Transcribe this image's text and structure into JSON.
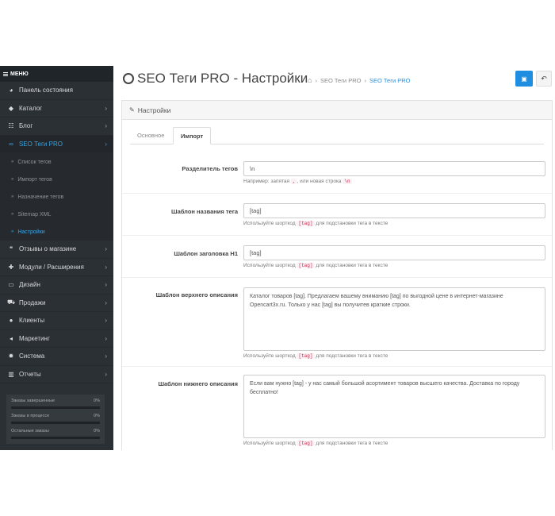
{
  "menu": {
    "title": "МЕНЮ"
  },
  "nav": [
    {
      "label": "Панель состояния",
      "icon": "dashboard-icon",
      "glyph": "◕",
      "chevron": false,
      "active": false
    },
    {
      "label": "Каталог",
      "icon": "tag-icon",
      "glyph": "◆",
      "chevron": true,
      "active": false
    },
    {
      "label": "Блог",
      "icon": "list-icon",
      "glyph": "☷",
      "chevron": true,
      "active": false
    },
    {
      "label": "SEO Теги PRO",
      "icon": "link-icon",
      "glyph": "∞",
      "chevron": true,
      "active": true
    }
  ],
  "subnav": [
    {
      "label": "Список тегов",
      "active": false
    },
    {
      "label": "Импорт тегов",
      "active": false
    },
    {
      "label": "Назначение тегов",
      "active": false
    },
    {
      "label": "Sitemap XML",
      "active": false
    },
    {
      "label": "Настройки",
      "active": true
    }
  ],
  "nav2": [
    {
      "label": "Отзывы о магазине",
      "icon": "comments-icon",
      "glyph": "❝",
      "chevron": true
    },
    {
      "label": "Модули / Расширения",
      "icon": "puzzle-icon",
      "glyph": "✚",
      "chevron": true
    },
    {
      "label": "Дизайн",
      "icon": "monitor-icon",
      "glyph": "▭",
      "chevron": true
    },
    {
      "label": "Продажи",
      "icon": "cart-icon",
      "glyph": "⛟",
      "chevron": true
    },
    {
      "label": "Клиенты",
      "icon": "user-icon",
      "glyph": "●",
      "chevron": true
    },
    {
      "label": "Маркетинг",
      "icon": "share-icon",
      "glyph": "◂",
      "chevron": true
    },
    {
      "label": "Система",
      "icon": "gear-icon",
      "glyph": "✹",
      "chevron": true
    },
    {
      "label": "Отчеты",
      "icon": "bar-chart-icon",
      "glyph": "▥",
      "chevron": true
    }
  ],
  "stats": [
    {
      "label": "Заказы завершенные",
      "value": "0%"
    },
    {
      "label": "Заказы в процессе",
      "value": "0%"
    },
    {
      "label": "Остальные заказы",
      "value": "0%"
    }
  ],
  "header": {
    "title": "SEO Теги PRO - Настройки",
    "breadcrumb": [
      "SEO Теги PRO",
      "SEO Теги PRO"
    ]
  },
  "panel": {
    "title": "Настройки",
    "tabs": [
      "Основное",
      "Импорт"
    ]
  },
  "form": {
    "separator": {
      "label": "Разделитель тегов",
      "value": "\\n",
      "help_prefix": "Например: запятая",
      "help_code1": ",",
      "help_mid": ", или новая строка",
      "help_code2": "\\n"
    },
    "name_tpl": {
      "label": "Шаблон названия тега",
      "value": "[tag]",
      "help_prefix": "Используйте шорткод",
      "help_code": "[tag]",
      "help_suffix": "для подстановки тега в тексте"
    },
    "h1_tpl": {
      "label": "Шаблон заголовка H1",
      "value": "[tag]",
      "help_prefix": "Используйте шорткод",
      "help_code": "[tag]",
      "help_suffix": "для подстановки тега в тексте"
    },
    "top_desc": {
      "label": "Шаблон верхнего описания",
      "value": "Каталог товаров [tag]. Предлагаем вашему вниманию [tag] по выгодной цене в интернет-магазине Opencart3x.ru. Только у нас [tag] вы получитев краткие строки.",
      "help_prefix": "Используйте шорткод",
      "help_code": "[tag]",
      "help_suffix": "для подстановки тега в тексте"
    },
    "bottom_desc": {
      "label": "Шаблон нижнего описания",
      "value": "Если вам нужно [tag] - у нас самый большой асортимент товаров высшего качества. Доставка по городу бесплатно!",
      "help_prefix": "Используйте шорткод",
      "help_code": "[tag]",
      "help_suffix": "для подстановки тега в тексте"
    }
  },
  "colors": {
    "accent": "#1f8de0",
    "sidebar": "#2b3035",
    "active_link": "#3aa3e3"
  }
}
